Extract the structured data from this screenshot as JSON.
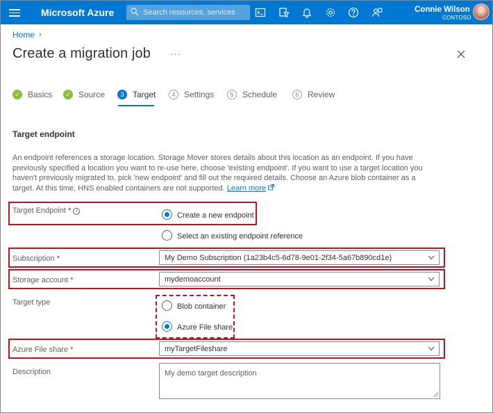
{
  "topbar": {
    "brand": "Microsoft Azure",
    "search_placeholder": "Search resources, services",
    "user_name": "Connie Wilson",
    "user_org": "CONTOSO",
    "accent": "#0078d4"
  },
  "breadcrumb": {
    "home": "Home"
  },
  "page": {
    "title": "Create a migration job",
    "ellipsis": "···"
  },
  "steps": [
    {
      "num": "1",
      "label": "Basics",
      "state": "done"
    },
    {
      "num": "2",
      "label": "Source",
      "state": "done"
    },
    {
      "num": "3",
      "label": "Target",
      "state": "current"
    },
    {
      "num": "4",
      "label": "Settings",
      "state": "todo"
    },
    {
      "num": "5",
      "label": "Schedule",
      "state": "todo"
    },
    {
      "num": "6",
      "label": "Review",
      "state": "todo"
    }
  ],
  "section": {
    "title": "Target endpoint",
    "description": "An endpoint references a storage location. Storage Mover stores details about this location as an endpoint. If you have previously specified a location you want to re-use here, choose 'existing endpoint'. If you want to use a target location you haven't previously migrated to, pick 'new endpoint' and fill out the required details. Choose an Azure blob container as a target. At this time, HNS enabled containers are not supported.",
    "learn_more": "Learn more"
  },
  "form": {
    "target_endpoint": {
      "label": "Target Endpoint",
      "required": "*",
      "options": [
        "Create a new endpoint",
        "Select an existing endpoint reference"
      ],
      "selected": "Create a new endpoint"
    },
    "subscription": {
      "label": "Subscription",
      "required": "*",
      "value": "My Demo Subscription (1a23b4c5-6d78-9e01-2f34-5a67b890cd1e)"
    },
    "storage_account": {
      "label": "Storage account",
      "required": "*",
      "value": "mydemoaccount"
    },
    "target_type": {
      "label": "Target type",
      "options": [
        "Blob container",
        "Azure File share"
      ],
      "selected": "Azure File share"
    },
    "file_share": {
      "label": "Azure File share",
      "required": "*",
      "value": "myTargetFileshare"
    },
    "description": {
      "label": "Description",
      "placeholder": "My demo target description"
    }
  }
}
